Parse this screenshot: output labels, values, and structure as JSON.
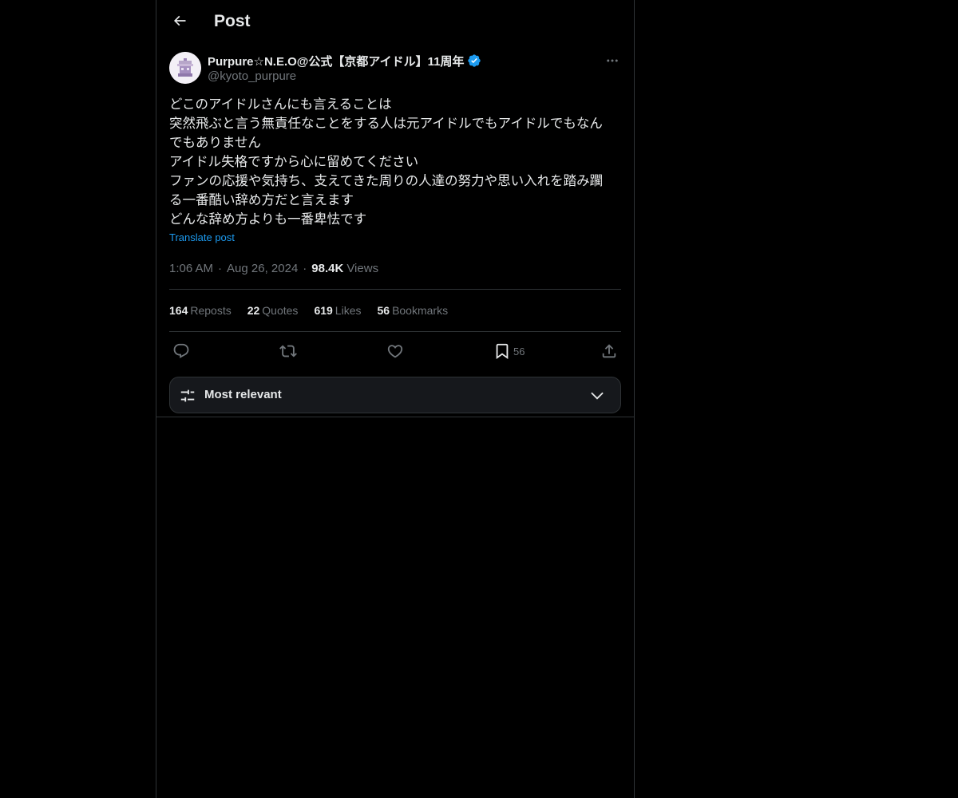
{
  "header": {
    "title": "Post"
  },
  "author": {
    "name": "Purpure☆N.E.O@公式【京都アイドル】11周年",
    "handle": "@kyoto_purpure"
  },
  "post": {
    "lines": [
      "どこのアイドルさんにも言えることは",
      "突然飛ぶと言う無責任なことをする人は元アイドルでもアイドルでもなん",
      "でもありません",
      "アイドル失格ですから心に留めてください",
      "ファンの応援や気持ち、支えてきた周りの人達の努力や思い入れを踏み躙",
      "る一番酷い辞め方だと言えます",
      "どんな辞め方よりも一番卑怯です"
    ],
    "translate_label": "Translate post",
    "time": "1:06 AM",
    "date": "Aug 26, 2024",
    "views_count": "98.4K",
    "views_label": "Views",
    "separator": "·"
  },
  "stats": {
    "reposts": {
      "count": "164",
      "label": "Reposts"
    },
    "quotes": {
      "count": "22",
      "label": "Quotes"
    },
    "likes": {
      "count": "619",
      "label": "Likes"
    },
    "bookmarks": {
      "count": "56",
      "label": "Bookmarks"
    }
  },
  "actions": {
    "bookmark_count": "56"
  },
  "sort": {
    "label": "Most relevant"
  },
  "colors": {
    "background": "#000000",
    "text": "#e7e9ea",
    "muted": "#71767b",
    "accent": "#1d9bf0",
    "border": "#2f3336"
  }
}
